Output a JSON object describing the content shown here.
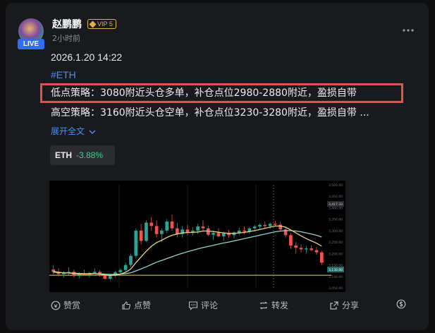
{
  "post": {
    "username": "赵鹏鹏",
    "vip_label": "VIP 5",
    "live_badge": "LIVE",
    "time_ago": "2小时前",
    "date": "2026.1.20 14:22",
    "hashtag": "#ETH",
    "line1": "低点策略：3080附近头仓多单，补仓点位2980-2880附近，盈损自带",
    "line2": "高空策略：3160附近头仓空单，补仓点位3230-3280附近，盈损自带 ...",
    "expand_label": "展开全文",
    "more_icon": "more-dots-icon"
  },
  "ticker": {
    "symbol": "ETH",
    "change": "-3.88%",
    "change_color": "#3fcf8e"
  },
  "actions": {
    "tip": "赞赏",
    "like": "点赞",
    "comment": "评论",
    "repost": "转发",
    "share": "分享"
  },
  "colors": {
    "accent": "#4e8df5",
    "highlight_box": "#e05252",
    "up": "#26a69a",
    "down": "#ef5350"
  },
  "chart_data": {
    "type": "line",
    "y_tick_labels": [
      "3,500.00",
      "3,450.00",
      "3,400.00",
      "3,350.00",
      "3,300.00",
      "3,250.00",
      "3,200.00",
      "3,150.00",
      "3,100.00",
      "3,050.00"
    ],
    "price_tag_top": "3,417.33",
    "price_tag_current": "3,130.00",
    "candles": [
      [
        3130,
        3150,
        3110,
        3120
      ],
      [
        3120,
        3135,
        3100,
        3110
      ],
      [
        3110,
        3125,
        3095,
        3115
      ],
      [
        3115,
        3140,
        3105,
        3120
      ],
      [
        3120,
        3130,
        3095,
        3102
      ],
      [
        3102,
        3118,
        3090,
        3112
      ],
      [
        3112,
        3130,
        3105,
        3108
      ],
      [
        3108,
        3120,
        3095,
        3115
      ],
      [
        3115,
        3135,
        3110,
        3120
      ],
      [
        3120,
        3128,
        3098,
        3105
      ],
      [
        3105,
        3112,
        3085,
        3090
      ],
      [
        3090,
        3108,
        3082,
        3102
      ],
      [
        3102,
        3125,
        3095,
        3118
      ],
      [
        3118,
        3135,
        3110,
        3128
      ],
      [
        3128,
        3160,
        3120,
        3150
      ],
      [
        3150,
        3200,
        3140,
        3190
      ],
      [
        3190,
        3310,
        3180,
        3300
      ],
      [
        3300,
        3330,
        3240,
        3255
      ],
      [
        3255,
        3345,
        3250,
        3335
      ],
      [
        3335,
        3360,
        3300,
        3320
      ],
      [
        3320,
        3345,
        3270,
        3285
      ],
      [
        3285,
        3310,
        3250,
        3300
      ],
      [
        3300,
        3350,
        3290,
        3340
      ],
      [
        3340,
        3370,
        3300,
        3310
      ],
      [
        3310,
        3335,
        3270,
        3285
      ],
      [
        3285,
        3320,
        3270,
        3305
      ],
      [
        3305,
        3325,
        3280,
        3290
      ],
      [
        3290,
        3315,
        3278,
        3300
      ],
      [
        3300,
        3330,
        3285,
        3318
      ],
      [
        3318,
        3345,
        3300,
        3310
      ],
      [
        3310,
        3322,
        3275,
        3282
      ],
      [
        3282,
        3300,
        3260,
        3290
      ],
      [
        3290,
        3310,
        3270,
        3275
      ],
      [
        3275,
        3295,
        3255,
        3288
      ],
      [
        3288,
        3302,
        3268,
        3280
      ],
      [
        3280,
        3298,
        3266,
        3292
      ],
      [
        3292,
        3312,
        3280,
        3300
      ],
      [
        3300,
        3318,
        3285,
        3295
      ],
      [
        3295,
        3315,
        3285,
        3310
      ],
      [
        3310,
        3325,
        3295,
        3318
      ],
      [
        3318,
        3332,
        3305,
        3325
      ],
      [
        3325,
        3340,
        3312,
        3320
      ],
      [
        3320,
        3336,
        3308,
        3330
      ],
      [
        3330,
        3342,
        3318,
        3326
      ],
      [
        3326,
        3338,
        3300,
        3305
      ],
      [
        3305,
        3318,
        3270,
        3280
      ],
      [
        3280,
        3290,
        3220,
        3235
      ],
      [
        3235,
        3250,
        3200,
        3225
      ],
      [
        3225,
        3240,
        3205,
        3218
      ],
      [
        3218,
        3232,
        3200,
        3222
      ],
      [
        3222,
        3236,
        3210,
        3215
      ],
      [
        3215,
        3228,
        3195,
        3205
      ],
      [
        3205,
        3212,
        3150,
        3160
      ]
    ],
    "ma_fast": [
      3122,
      3118,
      3115,
      3115,
      3112,
      3110,
      3110,
      3110,
      3112,
      3110,
      3106,
      3104,
      3106,
      3110,
      3118,
      3132,
      3160,
      3185,
      3210,
      3232,
      3248,
      3258,
      3270,
      3280,
      3285,
      3290,
      3292,
      3292,
      3294,
      3298,
      3298,
      3296,
      3293,
      3290,
      3288,
      3288,
      3290,
      3292,
      3296,
      3300,
      3305,
      3310,
      3315,
      3320,
      3320,
      3315,
      3303,
      3290,
      3277,
      3265,
      3255,
      3245,
      3232
    ],
    "ma_slow": [
      3118,
      3117,
      3116,
      3115,
      3114,
      3113,
      3112,
      3112,
      3112,
      3111,
      3110,
      3109,
      3109,
      3110,
      3112,
      3116,
      3124,
      3133,
      3142,
      3152,
      3162,
      3170,
      3178,
      3186,
      3194,
      3201,
      3208,
      3214,
      3220,
      3226,
      3231,
      3236,
      3241,
      3246,
      3250,
      3255,
      3260,
      3265,
      3270,
      3275,
      3280,
      3285,
      3290,
      3295,
      3298,
      3300,
      3300,
      3298,
      3295,
      3290,
      3285,
      3280,
      3272
    ],
    "ylim": [
      3050,
      3500
    ],
    "horizontal_line": 3105
  }
}
